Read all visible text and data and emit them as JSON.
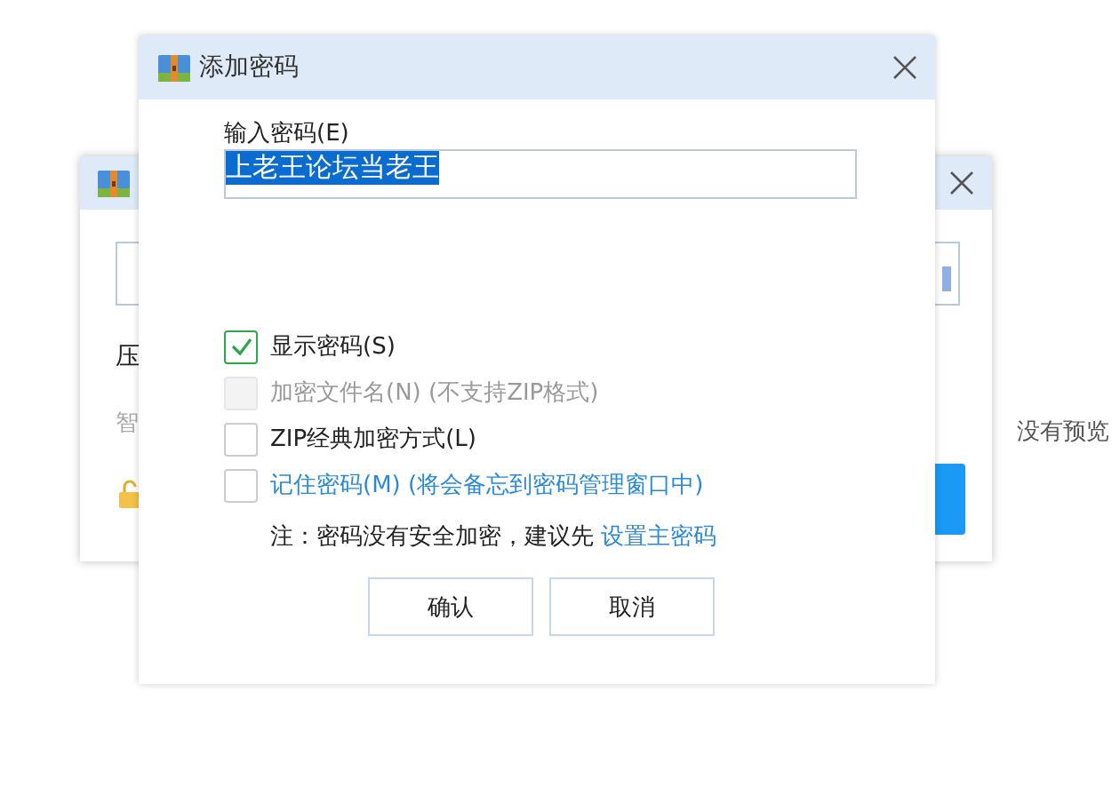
{
  "background_window": {
    "label": "压",
    "hint": "智"
  },
  "preview_text": "没有预览",
  "dialog": {
    "title": "添加密码",
    "password_label": "输入密码(E)",
    "password_value": "上老王论坛当老王",
    "options": [
      {
        "kind": "option",
        "label": "显示密码(S)",
        "checked": true,
        "disabled": false
      },
      {
        "kind": "option",
        "label": "加密文件名(N) (不支持ZIP格式)",
        "checked": false,
        "disabled": true
      },
      {
        "kind": "option",
        "label": "ZIP经典加密方式(L)",
        "checked": false,
        "disabled": false
      },
      {
        "kind": "link",
        "label": "记住密码(M) (将会备忘到密码管理窗口中)",
        "checked": false,
        "disabled": false
      }
    ],
    "note": "注：密码没有安全加密，建议先",
    "note_link": "设置主密码",
    "buttons": [
      "确认",
      "取消"
    ]
  }
}
